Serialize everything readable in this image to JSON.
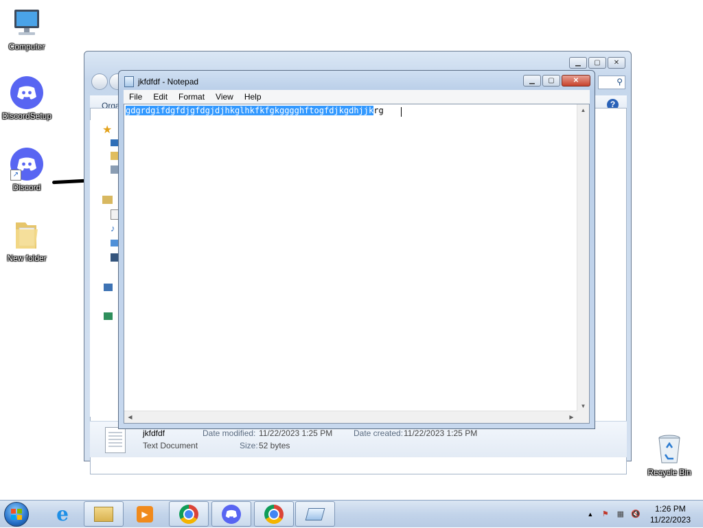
{
  "desktop": {
    "icons": [
      {
        "label": "Computer",
        "icon": "computer-icon"
      },
      {
        "label": "DiscordSetup",
        "icon": "discord-icon"
      },
      {
        "label": "Discord",
        "icon": "discord-icon"
      },
      {
        "label": "New folder",
        "icon": "folder-icon"
      },
      {
        "label": "Recycle Bin",
        "icon": "recycle-bin-icon"
      }
    ]
  },
  "explorer": {
    "toolbar_organize": "Orga",
    "details": {
      "name": "jkfdfdf",
      "type": "Text Document",
      "date_modified_label": "Date modified:",
      "date_modified": "11/22/2023 1:25 PM",
      "date_created_label": "Date created:",
      "date_created": "11/22/2023 1:25 PM",
      "size_label": "Size:",
      "size": "52 bytes"
    }
  },
  "notepad": {
    "title": "jkfdfdf - Notepad",
    "menu": [
      "File",
      "Edit",
      "Format",
      "View",
      "Help"
    ],
    "text_selected": "gdgrdgifdgfdjgfdgjdjhkglhkfkfgkgggghftogfdjkgdhjjk",
    "text_unselected": "rg"
  },
  "taskbar": {
    "time": "1:26 PM",
    "date": "11/22/2023",
    "pinned": [
      "internet-explorer-icon",
      "windows-explorer-icon",
      "media-player-icon",
      "chrome-profile-icon",
      "discord-icon",
      "chrome-icon",
      "notepad-icon"
    ]
  },
  "colors": {
    "selection": "#3399ff",
    "discord": "#5865f2",
    "close_button": "#c7412b"
  }
}
